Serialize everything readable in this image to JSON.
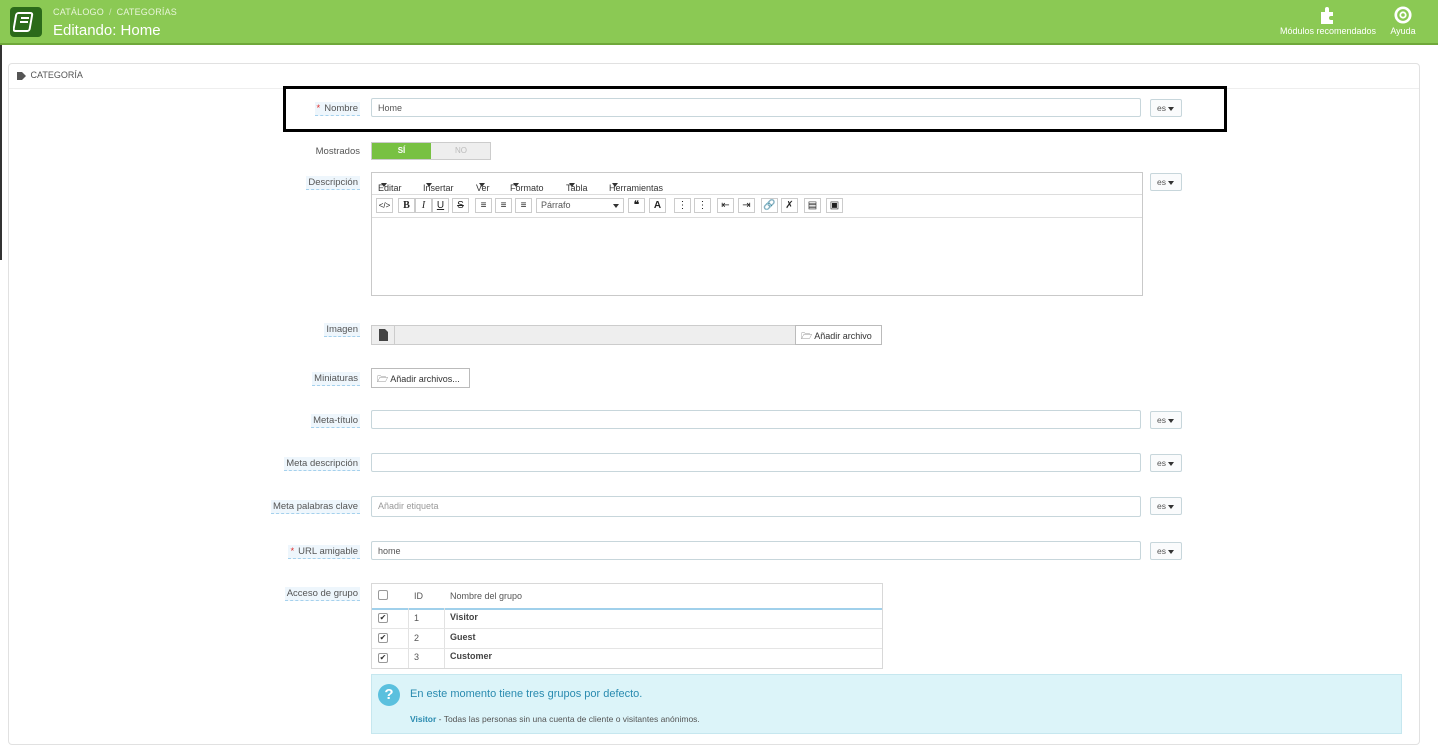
{
  "header": {
    "breadcrumb": [
      "CATÁLOGO",
      "CATEGORÍAS"
    ],
    "title": "Editando: Home",
    "buttons": {
      "modules": "Módulos recomendados",
      "help": "Ayuda"
    }
  },
  "panel": {
    "title": "CATEGORÍA"
  },
  "form": {
    "nombre": {
      "label": "Nombre",
      "value": "Home",
      "lang": "es"
    },
    "mostrados": {
      "label": "Mostrados",
      "yes": "SÍ",
      "no": "NO"
    },
    "descripcion": {
      "label": "Descripción",
      "lang": "es",
      "menu": [
        "Editar",
        "Insertar",
        "Ver",
        "Formato",
        "Tabla",
        "Herramientas"
      ],
      "format_select": "Párrafo"
    },
    "imagen": {
      "label": "Imagen",
      "button": "Añadir archivo"
    },
    "miniaturas": {
      "label": "Miniaturas",
      "button": "Añadir archivos..."
    },
    "meta_titulo": {
      "label": "Meta-título",
      "value": "",
      "lang": "es"
    },
    "meta_descripcion": {
      "label": "Meta descripción",
      "value": "",
      "lang": "es"
    },
    "meta_palabras": {
      "label": "Meta palabras clave",
      "placeholder": "Añadir etiqueta",
      "lang": "es"
    },
    "url_amigable": {
      "label": "URL amigable",
      "value": "home",
      "lang": "es"
    },
    "acceso_grupo": {
      "label": "Acceso de grupo",
      "headers": {
        "id": "ID",
        "name": "Nombre del grupo"
      },
      "rows": [
        {
          "id": "1",
          "name": "Visitor"
        },
        {
          "id": "2",
          "name": "Guest"
        },
        {
          "id": "3",
          "name": "Customer"
        }
      ]
    },
    "info": {
      "title": "En este momento tiene tres grupos por defecto.",
      "visitor_term": "Visitor",
      "visitor_desc": " - Todas las personas sin una cuenta de cliente o visitantes anónimos."
    }
  },
  "colors": {
    "topbar": "#8bc954",
    "switch_on": "#78c142",
    "info_bg": "#dcf4f9",
    "required": "#e0312d"
  }
}
